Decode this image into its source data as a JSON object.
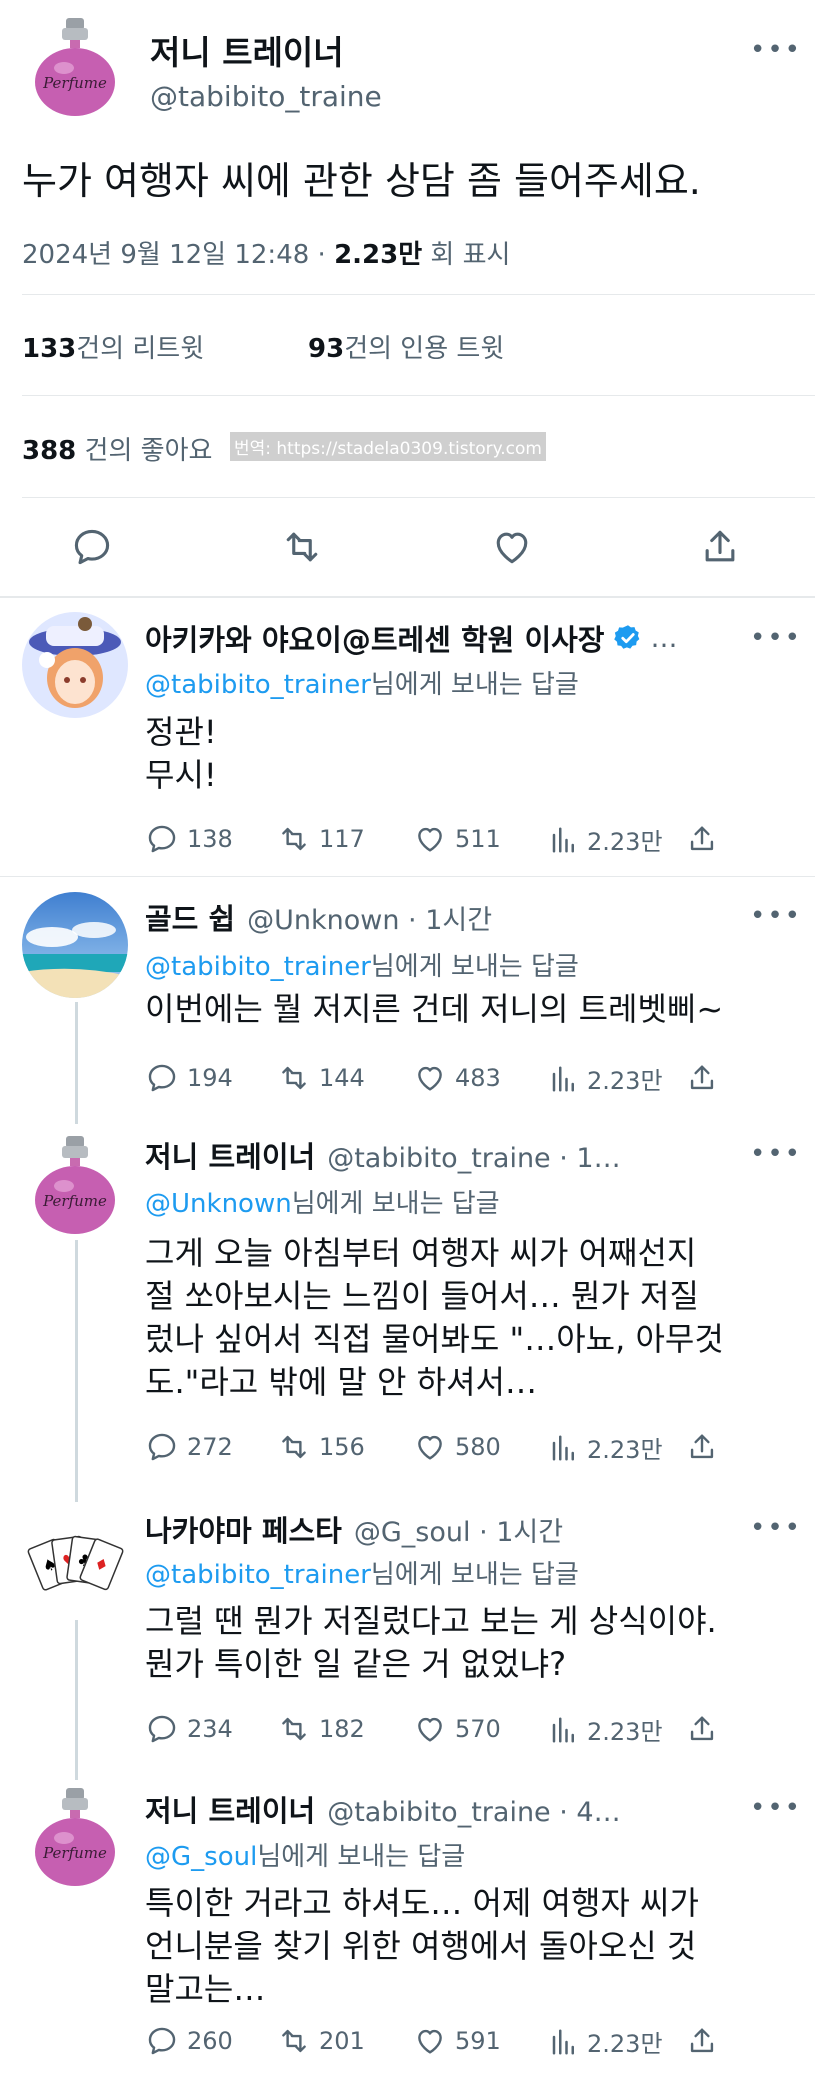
{
  "main": {
    "name": "저니 트레이너",
    "handle": "@tabibito_traine",
    "text": "누가 여행자 씨에 관한 상담 좀 들어주세요.",
    "timestamp": "2024년 9월 12일  12:48 ·",
    "views_count": "2.23만",
    "views_label": "회 표시",
    "retweets_count": "133",
    "retweets_label": "건의 리트윗",
    "quotes_count": "93",
    "quotes_label": "건의 인용 트윗",
    "likes_count": "388",
    "likes_label": "건의 좋아요",
    "watermark": "번역: https://stadela0309.tistory.com"
  },
  "replies": [
    {
      "name": "아키카와 야요이@트레센 학원 이사장",
      "handle": "…",
      "reply_to": "@tabibito_trainer",
      "reply_suffix": "님에게 보내는 답글",
      "text": "정관!\n무시!",
      "comments": "138",
      "retweets": "117",
      "likes": "511",
      "views": "2.23만"
    },
    {
      "name": "골드 쉽",
      "handle": "@Unknown · 1시간",
      "reply_to": "@tabibito_trainer",
      "reply_suffix": "님에게 보내는 답글",
      "text": "이번에는 뭘 저지른 건데 저니의 트레벳삐~",
      "comments": "194",
      "retweets": "144",
      "likes": "483",
      "views": "2.23만"
    },
    {
      "name": "저니 트레이너",
      "handle": "@tabibito_traine · 1…",
      "reply_to": "@Unknown",
      "reply_suffix": "님에게 보내는 답글",
      "text": "그게 오늘 아침부터 여행자 씨가 어째선지\n절 쏘아보시는 느낌이 들어서… 뭔가 저질\n렀나 싶어서 직접 물어봐도 \"…아뇨, 아무것\n도.\"라고 밖에 말 안 하셔서…",
      "comments": "272",
      "retweets": "156",
      "likes": "580",
      "views": "2.23만"
    },
    {
      "name": "나카야마 페스타",
      "handle": "@G_soul · 1시간",
      "reply_to": "@tabibito_trainer",
      "reply_suffix": "님에게 보내는 답글",
      "text": "그럴 땐 뭔가 저질렀다고 보는 게 상식이야.\n뭔가 특이한 일 같은 거 없었냐?",
      "comments": "234",
      "retweets": "182",
      "likes": "570",
      "views": "2.23만"
    },
    {
      "name": "저니 트레이너",
      "handle": "@tabibito_traine · 4…",
      "reply_to": "@G_soul",
      "reply_suffix": "님에게 보내는 답글",
      "text": "특이한 거라고 하셔도… 어제 여행자 씨가\n언니분을 찾기 위한 여행에서 돌아오신 것\n말고는…",
      "comments": "260",
      "retweets": "201",
      "likes": "591",
      "views": "2.23만"
    }
  ],
  "icons": {
    "perfume_label": "Perfume",
    "verified_color": "#1d9bf0"
  }
}
